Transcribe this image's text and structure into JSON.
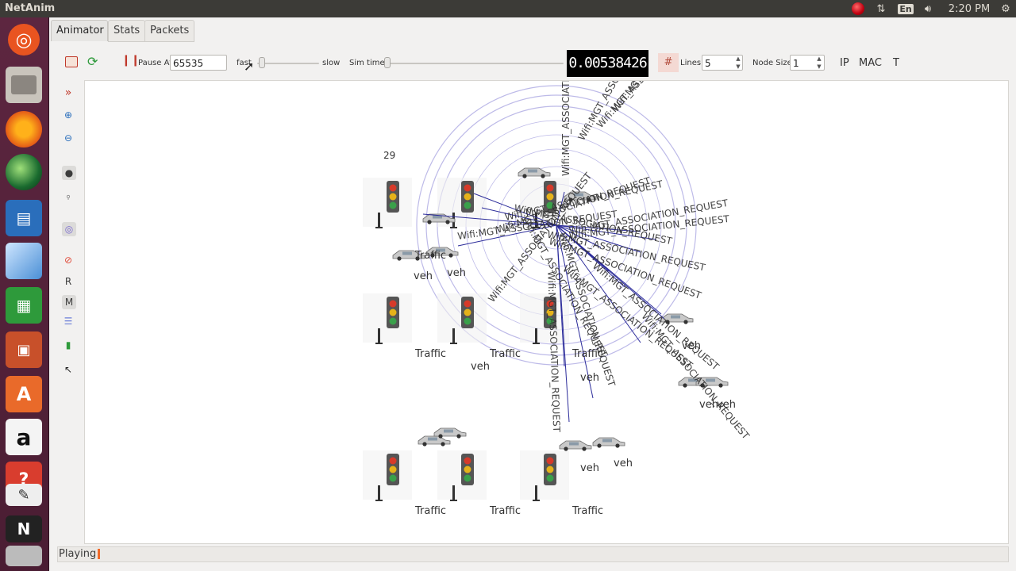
{
  "window": {
    "title": "NetAnim"
  },
  "system": {
    "time": "2:20 PM",
    "keyboard": "En"
  },
  "launcher": {
    "items": [
      {
        "name": "ubuntu-dash-icon"
      },
      {
        "name": "files-icon"
      },
      {
        "name": "firefox-icon"
      },
      {
        "name": "globe-icon"
      },
      {
        "name": "writer-icon"
      },
      {
        "name": "box-icon"
      },
      {
        "name": "calc-icon"
      },
      {
        "name": "impress-icon"
      },
      {
        "name": "software-center-icon"
      },
      {
        "name": "amazon-icon"
      },
      {
        "name": "settings-icon"
      },
      {
        "name": "editor-icon"
      },
      {
        "name": "netanim-icon"
      },
      {
        "name": "stack-icon"
      }
    ]
  },
  "tabs": [
    {
      "label": "Animator"
    },
    {
      "label": "Stats"
    },
    {
      "label": "Packets"
    }
  ],
  "toolbar": {
    "pause_at_label": "Pause At",
    "pause_at_value": "65535",
    "fast_label": "fast",
    "slow_label": "slow",
    "sim_time_label": "Sim time",
    "clock": "0.00538426",
    "lines_label": "Lines",
    "lines_value": "5",
    "node_size_label": "Node Size",
    "node_size_value": "1",
    "ip_label": "IP",
    "mac_label": "MAC",
    "t_label": "T"
  },
  "tools": {
    "r_label": "R",
    "m_label": "M"
  },
  "canvas": {
    "node_number": "29",
    "traffic_label": "Traffic",
    "vehicle_label": "veh",
    "packet_label": "Wifi:MGT_ASSOCIATION_REQUEST",
    "labels": [
      {
        "text": "Traffic"
      },
      {
        "text": "Traffic"
      },
      {
        "text": "Traffic"
      },
      {
        "text": "Traffic"
      },
      {
        "text": "Traffic"
      },
      {
        "text": "Traffic"
      },
      {
        "text": "Traffic"
      },
      {
        "text": "veh"
      },
      {
        "text": "veh"
      },
      {
        "text": "veh"
      },
      {
        "text": "veh"
      },
      {
        "text": "veh"
      },
      {
        "text": "veh"
      },
      {
        "text": "veh"
      },
      {
        "text": "veh"
      },
      {
        "text": "veh"
      }
    ]
  },
  "status": {
    "text": "Playing"
  },
  "colors": {
    "launcher": "#5d2640",
    "packet_line": "#2b2b9a",
    "range_circle": "#a7a3e0",
    "clock_bg": "#000000"
  }
}
